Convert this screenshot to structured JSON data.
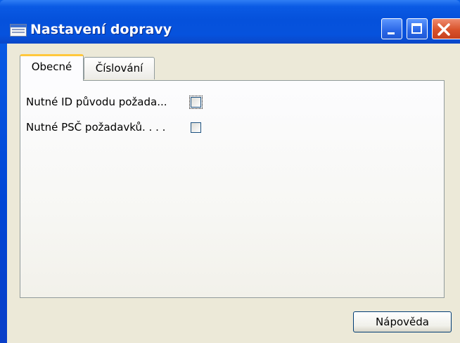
{
  "window": {
    "title": "Nastavení dopravy",
    "title_bar_color": "#0554dc",
    "icons": [
      "grid-app-icon",
      "minimize-icon",
      "maximize-icon",
      "close-icon"
    ]
  },
  "tabs": [
    {
      "label": "Obecné",
      "active": true
    },
    {
      "label": "Číslování",
      "active": false
    }
  ],
  "fields": [
    {
      "label": "Nutné ID původu požada...",
      "checked": false,
      "focused": true
    },
    {
      "label": "Nutné PSČ požadavků. . . .",
      "checked": false,
      "focused": false
    }
  ],
  "buttons": {
    "help_label": "Nápověda"
  }
}
